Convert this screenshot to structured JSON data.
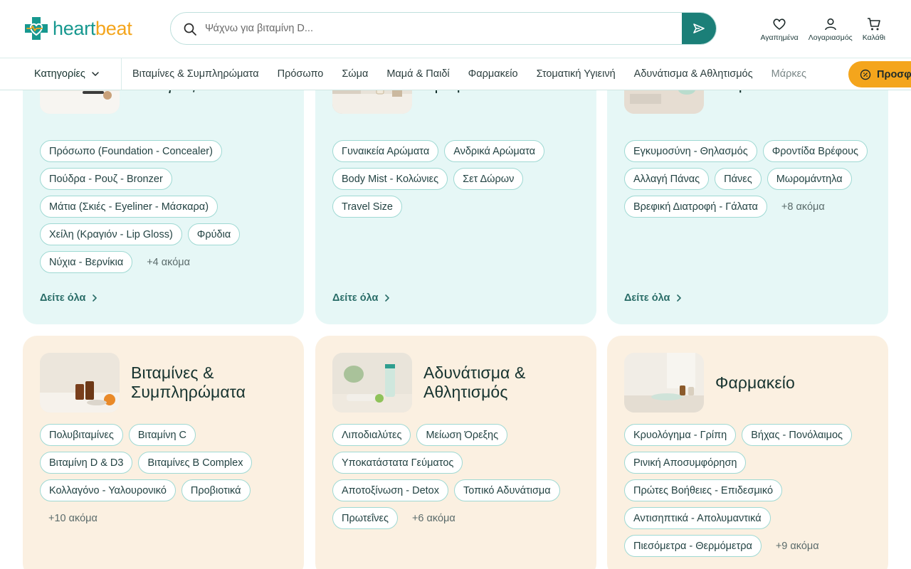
{
  "header": {
    "logo_text_a": "heart",
    "logo_text_b": "beat",
    "search_placeholder": "Ψάχνω για βιταμίνη D...",
    "favorites_label": "Αγαπημένα",
    "account_label": "Λογαριασμός",
    "cart_label": "Καλάθι"
  },
  "nav": {
    "categories_label": "Κατηγορίες",
    "links": [
      "Βιταμίνες & Συμπληρώματα",
      "Πρόσωπο",
      "Σώμα",
      "Μαμά & Παιδί",
      "Φαρμακείο",
      "Στοματική Υγιεινή",
      "Αδυνάτισμα & Αθλητισμός"
    ],
    "brands_label": "Μάρκες",
    "promo_label": "Προσφο"
  },
  "cards": [
    {
      "title": "Μακιγιάζ",
      "tags": [
        "Πρόσωπο (Foundation - Concealer)",
        "Πούδρα - Ρουζ - Bronzer",
        "Μάτια (Σκιές - Eyeliner - Μάσκαρα)",
        "Χείλη (Κραγιόν - Lip Gloss)",
        "Φρύδια",
        "Νύχια - Βερνίκια"
      ],
      "more": "+4 ακόμα",
      "see_all": "Δείτε όλα"
    },
    {
      "title": "Αρώματα",
      "tags": [
        "Γυναικεία Αρώματα",
        "Ανδρικά Αρώματα",
        "Body Mist - Κολώνιες",
        "Σετ Δώρων",
        "Travel Size"
      ],
      "more": "",
      "see_all": "Δείτε όλα"
    },
    {
      "title": "Μαμά & Παιδί",
      "tags": [
        "Εγκυμοσύνη - Θηλασμός",
        "Φροντίδα Βρέφους",
        "Αλλαγή Πάνας",
        "Πάνες",
        "Μωρομάντηλα",
        "Βρεφική Διατροφή - Γάλατα"
      ],
      "more": "+8 ακόμα",
      "see_all": "Δείτε όλα"
    },
    {
      "title": "Βιταμίνες & Συμπληρώματα",
      "tags": [
        "Πολυβιταμίνες",
        "Βιταμίνη C",
        "Βιταμίνη D & D3",
        "Βιταμίνες B Complex",
        "Κολλαγόνο - Υαλουρονικό",
        "Προβιοτικά"
      ],
      "more": "+10 ακόμα"
    },
    {
      "title": "Αδυνάτισμα & Αθλητισμός",
      "tags": [
        "Λιποδιαλύτες",
        "Μείωση Όρεξης",
        "Υποκατάστατα Γεύματος",
        "Αποτοξίνωση - Detox",
        "Τοπικό Αδυνάτισμα",
        "Πρωτεΐνες"
      ],
      "more": "+6 ακόμα"
    },
    {
      "title": "Φαρμακείο",
      "tags": [
        "Κρυολόγημα - Γρίπη",
        "Βήχας - Πονόλαιμος",
        "Ρινική Αποσυμφόρηση",
        "Πρώτες Βοήθειες - Επιδεσμικό",
        "Αντισηπτικά - Απολυμαντικά",
        "Πιεσόμετρα - Θερμόμετρα"
      ],
      "more": "+9 ακόμα"
    }
  ],
  "colors": {
    "brand_teal": "#17988f",
    "brand_orange": "#f4a51c",
    "card_mint": "#e6f7f6",
    "card_cream": "#fbf0e1"
  }
}
